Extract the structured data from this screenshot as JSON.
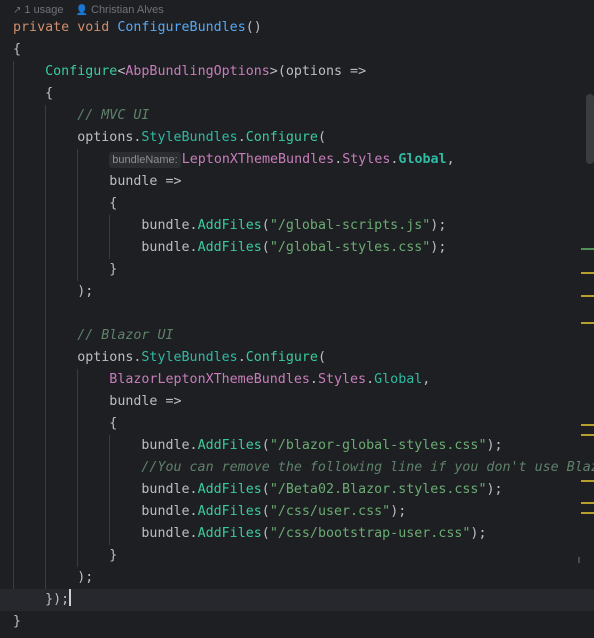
{
  "hint": {
    "usages": "1 usage",
    "author": "Christian Alves"
  },
  "code": {
    "l1": {
      "kw1": "private",
      "kw2": "void",
      "fn": "ConfigureBundles",
      "rest": "()"
    },
    "l2": "{",
    "l3": {
      "method": "Configure",
      "lt": "<",
      "type": "AbpBundlingOptions",
      "rest": ">(options =>"
    },
    "l4": "{",
    "l5": "// MVC UI",
    "l6": {
      "obj": "options",
      "dot1": ".",
      "prop": "StyleBundles",
      "dot2": ".",
      "call": "Configure",
      "paren": "("
    },
    "l7": {
      "hint": "bundleName:",
      "cls": "LeptonXThemeBundles",
      "dot1": ".",
      "styles": "Styles",
      "dot2": ".",
      "global": "Global",
      "comma": ","
    },
    "l8": "bundle =>",
    "l9": "{",
    "l10": {
      "obj": "bundle",
      "dot": ".",
      "call": "AddFiles",
      "open": "(",
      "str": "\"/global-scripts.js\"",
      "close": ");"
    },
    "l11": {
      "obj": "bundle",
      "dot": ".",
      "call": "AddFiles",
      "open": "(",
      "str": "\"/global-styles.css\"",
      "close": ");"
    },
    "l12": "}",
    "l13": ");",
    "l15": "// Blazor UI",
    "l16": {
      "obj": "options",
      "dot1": ".",
      "prop": "StyleBundles",
      "dot2": ".",
      "call": "Configure",
      "paren": "("
    },
    "l17": {
      "cls": "BlazorLeptonXThemeBundles",
      "dot1": ".",
      "styles": "Styles",
      "dot2": ".",
      "global": "Global",
      "comma": ","
    },
    "l18": "bundle =>",
    "l19": "{",
    "l20": {
      "obj": "bundle",
      "dot": ".",
      "call": "AddFiles",
      "open": "(",
      "str": "\"/blazor-global-styles.css\"",
      "close": ");"
    },
    "l21": "//You can remove the following line if you don't use Blazor",
    "l22": {
      "obj": "bundle",
      "dot": ".",
      "call": "AddFiles",
      "open": "(",
      "str": "\"/Beta02.Blazor.styles.css\"",
      "close": ");"
    },
    "l23": {
      "obj": "bundle",
      "dot": ".",
      "call": "AddFiles",
      "open": "(",
      "str": "\"/css/user.css\"",
      "close": ");"
    },
    "l24": {
      "obj": "bundle",
      "dot": ".",
      "call": "AddFiles",
      "open": "(",
      "str": "\"/css/bootstrap-user.css\"",
      "close": ");"
    },
    "l25": "}",
    "l26": ");",
    "l27": "});",
    "l28": "}"
  },
  "colors": {
    "background": "#1e1f22",
    "keyword": "#cf8e6d",
    "function": "#56a8f5",
    "type": "#c77dbb",
    "method": "#39cc9b",
    "string": "#6aab73",
    "comment": "#7a7e85"
  },
  "icons": [
    "usages-icon",
    "author-icon"
  ]
}
